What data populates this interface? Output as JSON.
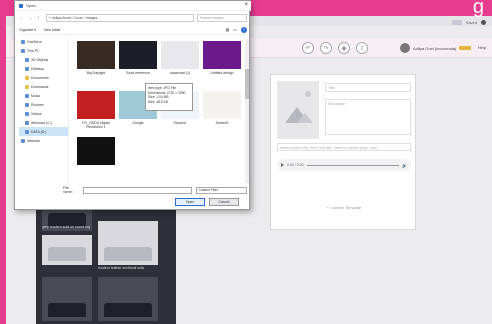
{
  "corner_text": "g",
  "browser": {
    "zoom_label": "Saved",
    "header_user": "Aditya Goel (Incoronata)",
    "help": "Help"
  },
  "dialog": {
    "title": "Open",
    "path": "‹‹ Aditya Arora › Ucraì › Images",
    "search_placeholder": "Search Images",
    "toolbar": {
      "organize": "Organize ▾",
      "new_folder": "New folder"
    },
    "nav_items": [
      {
        "label": "OneDrive",
        "glyph": "cloud-icon",
        "sub": false
      },
      {
        "label": "This PC",
        "glyph": "computer-icon",
        "sub": false
      },
      {
        "label": "3D Objects",
        "glyph": "cube-icon",
        "sub": true
      },
      {
        "label": "Desktop",
        "glyph": "desktop-icon",
        "sub": true
      },
      {
        "label": "Documents",
        "glyph": "document-icon",
        "sub": true
      },
      {
        "label": "Downloads",
        "glyph": "download-icon",
        "sub": true
      },
      {
        "label": "Music",
        "glyph": "music-icon",
        "sub": true
      },
      {
        "label": "Pictures",
        "glyph": "picture-icon",
        "sub": true
      },
      {
        "label": "Videos",
        "glyph": "video-icon",
        "sub": true
      },
      {
        "label": "Windows (C:)",
        "glyph": "drive-icon",
        "sub": true
      },
      {
        "label": "DATA (D:)",
        "glyph": "drive-icon",
        "sub": true,
        "selected": true
      },
      {
        "label": "Network",
        "glyph": "network-icon",
        "sub": false
      }
    ],
    "files": [
      {
        "name": "Big Daylight",
        "color": "#3a2a24"
      },
      {
        "name": "Scott reference",
        "color": "#1e1e28"
      },
      {
        "name": "download (1)",
        "color": "#e8e8ec"
      },
      {
        "name": "Untitled design",
        "color": "#6a1a8a"
      },
      {
        "name": "FG_GSDS Digital Revolution 1",
        "color": "#c22020"
      },
      {
        "name": "Google",
        "color": "#9ec9d6"
      },
      {
        "name": "Search1",
        "color": "#eef5f8"
      },
      {
        "name": "Search2",
        "color": "#f4f2ef"
      },
      {
        "name": "",
        "color": "#111111"
      }
    ],
    "tooltip": [
      "Item type: JPG File",
      "Dimensions: 2732 × 2050",
      "Size: 1.04 MB",
      "Size: 48.8 KB"
    ],
    "file_name_label": "File name:",
    "file_type": "Custom Files",
    "open_label": "Open",
    "cancel_label": "Cancel"
  },
  "left_panel": {
    "captions": [
      "grey modern sofa on round rug",
      "modern leather sectional sofa"
    ]
  },
  "card": {
    "title_placeholder": "Title",
    "desc_placeholder": "Description",
    "url_placeholder": "Insert a video URL from YouTube, Vimeo or upload (mp4, mov)",
    "audio_time": "0:00 / 0:00",
    "add_dropdown": "+ Content Template"
  }
}
